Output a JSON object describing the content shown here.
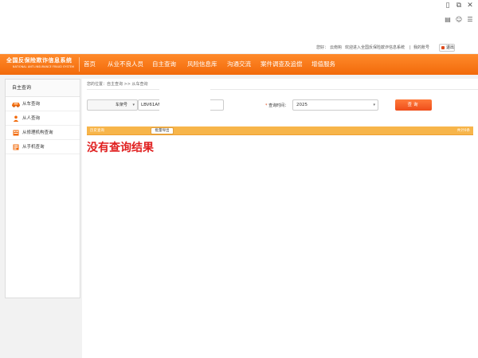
{
  "topbar": {
    "greeting": "您好：",
    "username": "云南钩",
    "welcome": "欢迎进入全国反保险欺诈信息系统",
    "separator": "|",
    "account": "我的账号",
    "logout": "退出"
  },
  "logo": {
    "cn": "全国反保险欺诈信息系统",
    "en": "NATIONAL ANTI-INSURANCE FRAUD SYSTEM"
  },
  "nav": {
    "items": [
      {
        "label": "首页"
      },
      {
        "label": "从业不良人员"
      },
      {
        "label": "自主查询"
      },
      {
        "label": "风险信息库"
      },
      {
        "label": "沟通交流"
      },
      {
        "label": "案件调查及追偿"
      },
      {
        "label": "增值服务"
      }
    ]
  },
  "sidebar": {
    "title": "自主查询",
    "items": [
      {
        "label": "从车查询",
        "icon": "car-icon"
      },
      {
        "label": "从人查询",
        "icon": "person-icon"
      },
      {
        "label": "从修理机构查询",
        "icon": "building-icon"
      },
      {
        "label": "从手机查询",
        "icon": "phone-icon"
      }
    ]
  },
  "main": {
    "breadcrumb": "您的位置：自主查询 >> 从车查询",
    "plate_type": "车架号",
    "plate_value": "LBV61AF0",
    "time_label": "查询时间：",
    "time_required": "*",
    "time_value": "2025",
    "query_button": "查询",
    "history_label": "历史查询",
    "export_button": "批量导出",
    "total_label": "共计0条",
    "no_result": "没有查询结果"
  },
  "colors": {
    "accent": "#f26a0a",
    "danger": "#e02020",
    "result_bar": "#f7b54a"
  }
}
